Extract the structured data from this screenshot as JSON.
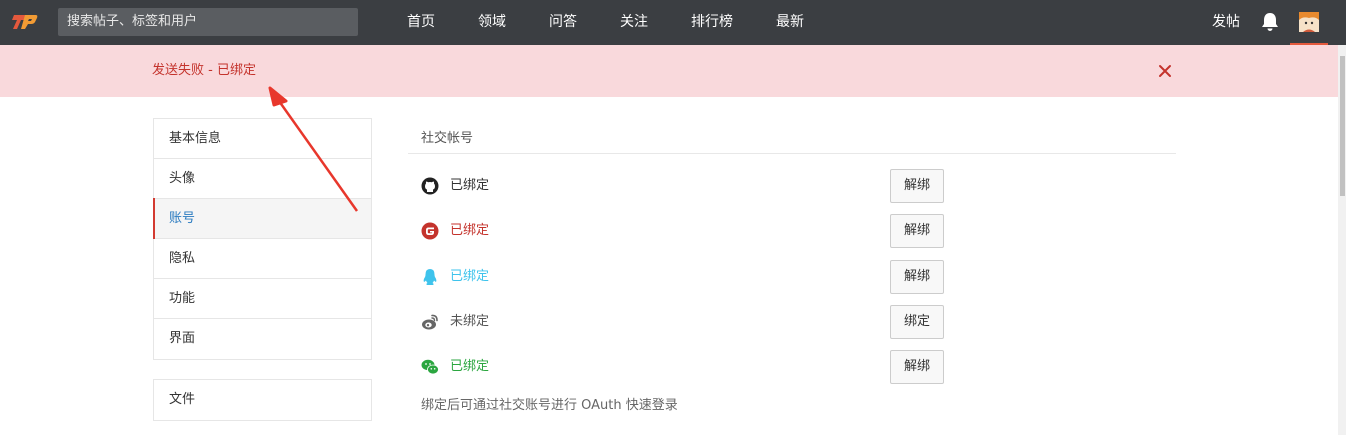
{
  "header": {
    "search_placeholder": "搜索帖子、标签和用户",
    "nav": [
      "首页",
      "领域",
      "问答",
      "关注",
      "排行榜",
      "最新"
    ],
    "post_label": "发帖"
  },
  "alert": {
    "message": "发送失败 - 已绑定"
  },
  "sidebar": {
    "items": [
      "基本信息",
      "头像",
      "账号",
      "隐私",
      "功能",
      "界面"
    ],
    "active_index": 2,
    "extra": "文件"
  },
  "social": {
    "title": "社交帐号",
    "accounts": [
      {
        "icon": "github-icon",
        "status": "已绑定",
        "action": "解绑",
        "color": "#333333"
      },
      {
        "icon": "gitee-icon",
        "status": "已绑定",
        "action": "解绑",
        "color": "#c4332c"
      },
      {
        "icon": "qq-icon",
        "status": "已绑定",
        "action": "解绑",
        "color": "#3ec3ec"
      },
      {
        "icon": "weibo-icon",
        "status": "未绑定",
        "action": "绑定",
        "color": "#555555"
      },
      {
        "icon": "wechat-icon",
        "status": "已绑定",
        "action": "解绑",
        "color": "#2ba640"
      }
    ],
    "hint": "绑定后可通过社交账号进行 OAuth 快速登录"
  },
  "colors": {
    "topbar": "#3b3e42",
    "alert_bg": "#f9d9dc",
    "alert_text": "#c4332c",
    "active_link": "#2b7bc0"
  }
}
